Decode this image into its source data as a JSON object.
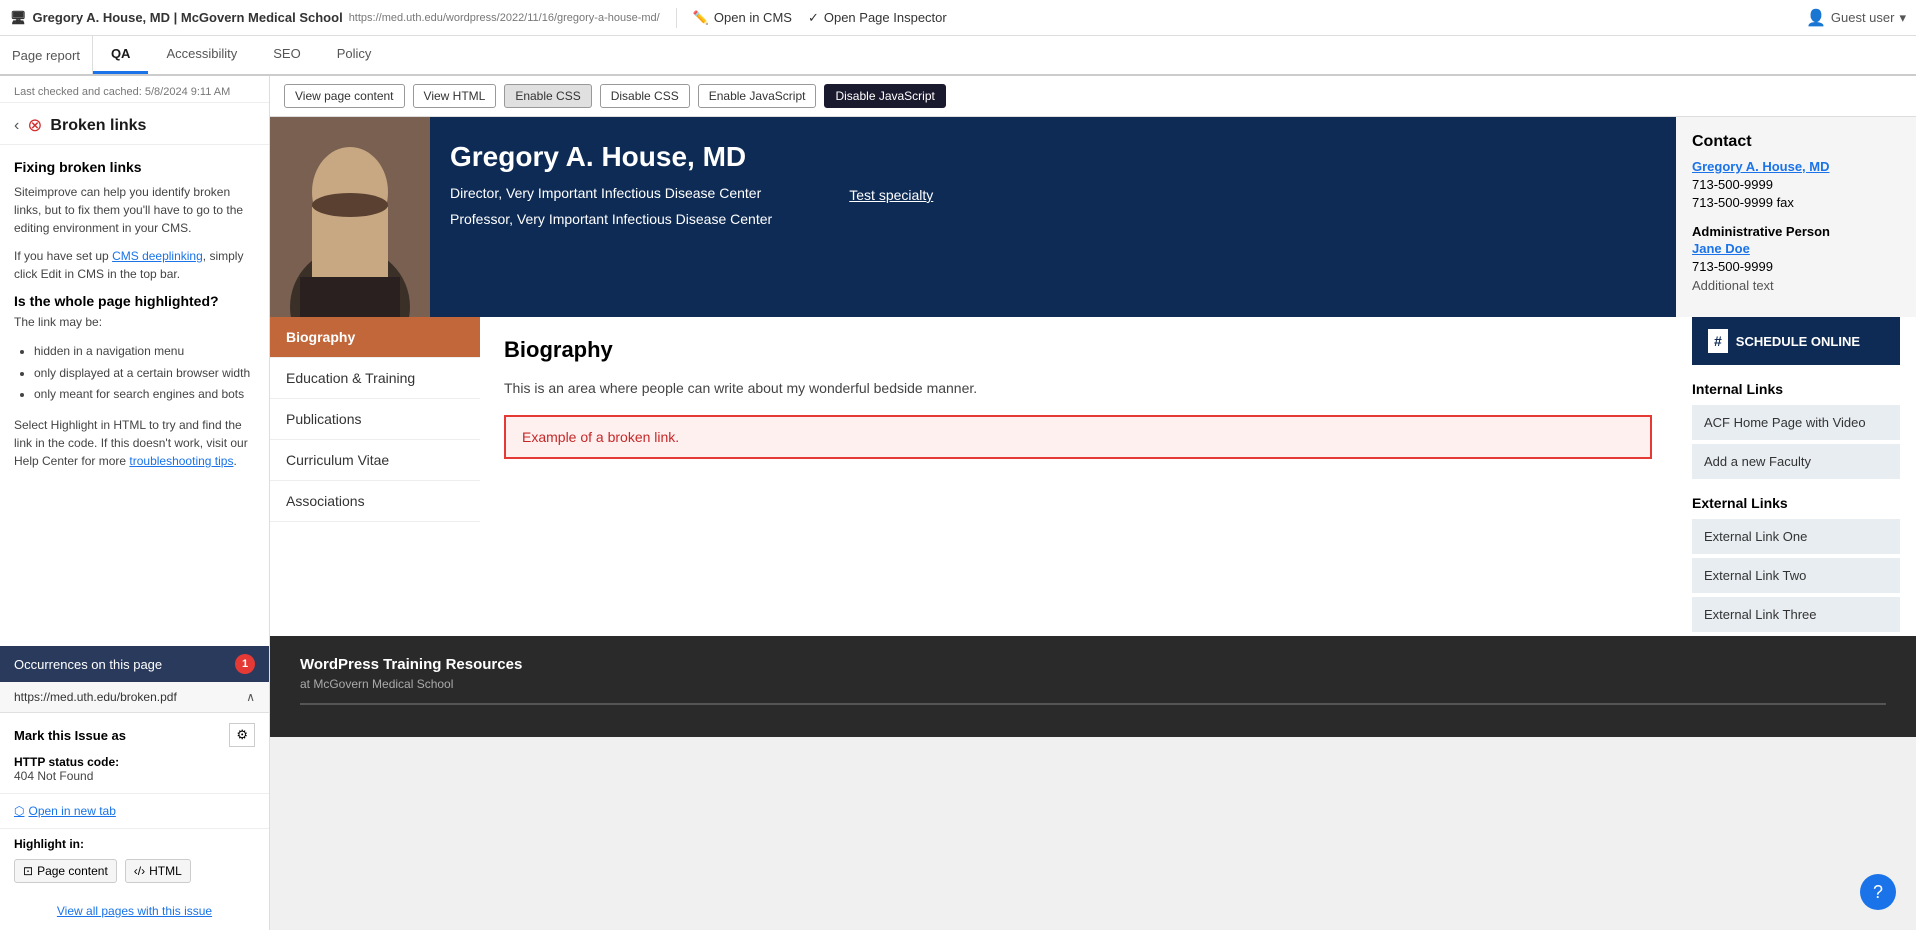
{
  "topbar": {
    "page_info": "Gregory A. House, MD | McGovern Medical School",
    "page_url": "https://med.uth.edu/wordpress/2022/11/16/gregory-a-house-md/",
    "open_cms_label": "Open in CMS",
    "open_inspector_label": "Open Page Inspector",
    "user_label": "Guest user"
  },
  "tabs": [
    {
      "id": "qa",
      "label": "QA",
      "active": true
    },
    {
      "id": "accessibility",
      "label": "Accessibility",
      "active": false
    },
    {
      "id": "seo",
      "label": "SEO",
      "active": false
    },
    {
      "id": "policy",
      "label": "Policy",
      "active": false
    }
  ],
  "sidebar": {
    "last_checked": "Last checked and cached: 5/8/2024 9:11 AM",
    "broken_links_title": "Broken links",
    "fixing_title": "Fixing broken links",
    "fixing_p1": "Siteimprove can help you identify broken links, but to fix them you'll have to go to the editing environment in your CMS.",
    "fixing_p2": "If you have set up ",
    "cms_link": "CMS deeplinking",
    "fixing_p2b": ", simply click Edit in CMS in the top bar.",
    "highlighted_title": "Is the whole page highlighted?",
    "highlighted_desc": "The link may be:",
    "highlighted_items": [
      "hidden in a navigation menu",
      "only displayed at a certain browser width",
      "only meant for search engines and bots"
    ],
    "select_highlight": "Select Highlight in HTML to try and find the link in the code. If this doesn't work, visit our Help Center for more ",
    "troubleshooting_link": "troubleshooting tips",
    "occurrences_label": "Occurrences on this page",
    "occurrences_count": "1",
    "url": "https://med.uth.edu/broken.pdf",
    "mark_issue_label": "Mark this Issue as",
    "http_status_label": "HTTP status code:",
    "http_status_value": "404 Not Found",
    "open_tab_label": "Open in new tab",
    "highlight_label": "Highlight in:",
    "highlight_page_btn": "Page content",
    "highlight_html_btn": "HTML",
    "view_all_label": "View all pages with this issue"
  },
  "toolbar": {
    "view_page_content": "View page content",
    "view_html": "View HTML",
    "enable_css": "Enable CSS",
    "disable_css": "Disable CSS",
    "enable_js": "Enable JavaScript",
    "disable_js": "Disable JavaScript"
  },
  "profile": {
    "name": "Gregory A. House, MD",
    "title1": "Director, Very Important Infectious Disease Center",
    "title2": "Professor, Very Important Infectious Disease Center",
    "test_link": "Test specialty",
    "contact_heading": "Contact",
    "contact_name": "Gregory A. House, MD",
    "phone1": "713-500-9999",
    "phone2": "713-500-9999 fax",
    "admin_label": "Administrative Person",
    "admin_name": "Jane Doe",
    "admin_phone": "713-500-9999",
    "additional": "Additional text"
  },
  "nav_items": [
    {
      "label": "Biography",
      "active": true
    },
    {
      "label": "Education & Training",
      "active": false
    },
    {
      "label": "Publications",
      "active": false
    },
    {
      "label": "Curriculum Vitae",
      "active": false
    },
    {
      "label": "Associations",
      "active": false
    }
  ],
  "bio": {
    "heading": "Biography",
    "text": "This is an area where people can write about my wonderful bedside manner.",
    "broken_link_text": "Example of a broken link."
  },
  "right_sidebar": {
    "schedule_label": "SCHEDULE ONLINE",
    "internal_links_heading": "Internal Links",
    "internal_links": [
      "ACF Home Page with Video",
      "Add a new Faculty"
    ],
    "external_links_heading": "External Links",
    "external_links": [
      "External Link One",
      "External Link Two",
      "External Link Three"
    ]
  },
  "footer": {
    "title": "WordPress Training Resources",
    "subtitle": "at McGovern Medical School"
  }
}
